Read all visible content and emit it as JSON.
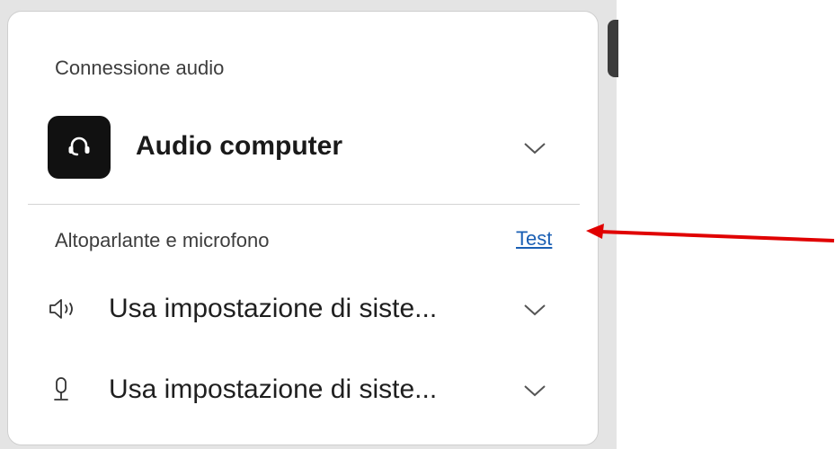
{
  "panel": {
    "connection_label": "Connessione audio",
    "audio_option": {
      "title": "Audio computer",
      "icon": "headset-icon"
    },
    "devices_label": "Altoparlante e microfono",
    "test_link": "Test",
    "speaker": {
      "icon": "speaker-icon",
      "value": "Usa impostazione di siste..."
    },
    "microphone": {
      "icon": "microphone-icon",
      "value": "Usa impostazione di siste..."
    }
  },
  "annotation": {
    "arrow_color": "#e00000",
    "points_to": "Test"
  },
  "colors": {
    "link": "#1a5fb4",
    "icon_tile": "#111111",
    "backdrop": "#e4e4e4"
  }
}
